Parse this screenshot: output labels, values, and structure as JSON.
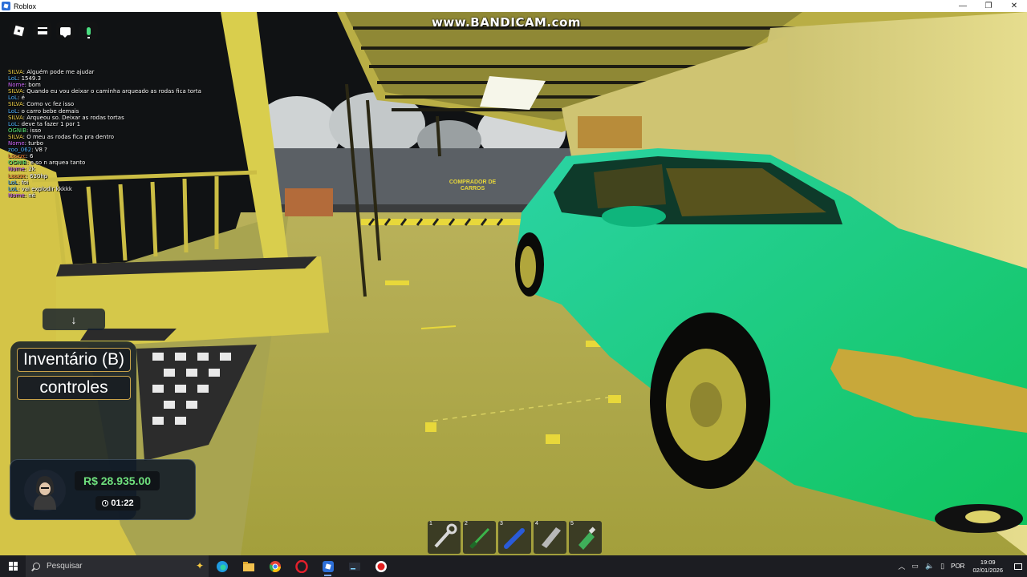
{
  "window": {
    "title": "Roblox",
    "controls": [
      "—",
      "❐",
      "✕"
    ]
  },
  "watermark": "www.BANDICAM.com",
  "scene_sign": [
    "COMPRADOR DE",
    "CARROS"
  ],
  "toolbar": {
    "icons": [
      "roblox-logo-icon",
      "menu-icon",
      "chat-icon",
      "microphone-icon"
    ]
  },
  "chat": {
    "messages": [
      {
        "name": "SILVA",
        "name_color": "#f2d34a",
        "text": "Alguém pode me ajudar"
      },
      {
        "name": "LoL",
        "name_color": "#4fb3ff",
        "text": "1549.3"
      },
      {
        "name": "Nome",
        "name_color": "#d36bff",
        "text": "bom"
      },
      {
        "name": "SILVA",
        "name_color": "#f2d34a",
        "text": "Quando eu vou deixar o caminha arqueado as rodas fica torta"
      },
      {
        "name": "LoL",
        "name_color": "#4fb3ff",
        "text": "é"
      },
      {
        "name": "SILVA",
        "name_color": "#f2d34a",
        "text": "Como vc fez isso"
      },
      {
        "name": "LoL",
        "name_color": "#4fb3ff",
        "text": "o carro bebe demais"
      },
      {
        "name": "SILVA",
        "name_color": "#f2d34a",
        "text": "Arqueou so. Deixar as rodas tortas"
      },
      {
        "name": "LoL",
        "name_color": "#4fb3ff",
        "text": "deve ta fazer 1 por 1"
      },
      {
        "name": "OGNIB",
        "name_color": "#5cf07a",
        "text": "isso"
      },
      {
        "name": "SILVA",
        "name_color": "#f2d34a",
        "text": "O meu as rodas fica pra dentro"
      },
      {
        "name": "Nome",
        "name_color": "#d36bff",
        "text": "turbo"
      },
      {
        "name": "zoo_062",
        "name_color": "#4fb3ff",
        "text": "V8 ?"
      },
      {
        "name": "Lsszzc",
        "name_color": "#ff8a3d",
        "text": "6"
      },
      {
        "name": "OGNIB",
        "name_color": "#5cf07a",
        "text": "e so n arquea tanto"
      },
      {
        "name": "Nome",
        "name_color": "#d36bff",
        "text": "2k"
      },
      {
        "name": "Lsszzc",
        "name_color": "#ff8a3d",
        "text": "630hp"
      },
      {
        "name": "LoL",
        "name_color": "#4fb3ff",
        "text": "foi"
      },
      {
        "name": "LoL",
        "name_color": "#4fb3ff",
        "text": "vai explodir kkkkk"
      },
      {
        "name": "Nome",
        "name_color": "#d36bff",
        "text": "né"
      }
    ]
  },
  "panel": {
    "down_arrow": "↓",
    "inventory_label": "Inventário (B)",
    "controls_label": "controles",
    "money": "R$ 28.935.00",
    "timer": "01:22"
  },
  "hotbar": [
    {
      "num": "1",
      "icon": "wrench-icon"
    },
    {
      "num": "2",
      "icon": "screwdriver-icon"
    },
    {
      "num": "3",
      "icon": "blue-tool-icon"
    },
    {
      "num": "4",
      "icon": "metal-bar-icon"
    },
    {
      "num": "5",
      "icon": "spray-bottle-icon"
    }
  ],
  "taskbar": {
    "search_placeholder": "Pesquisar",
    "lang": "POR",
    "time": "19:09",
    "date": "02/01/2026"
  }
}
